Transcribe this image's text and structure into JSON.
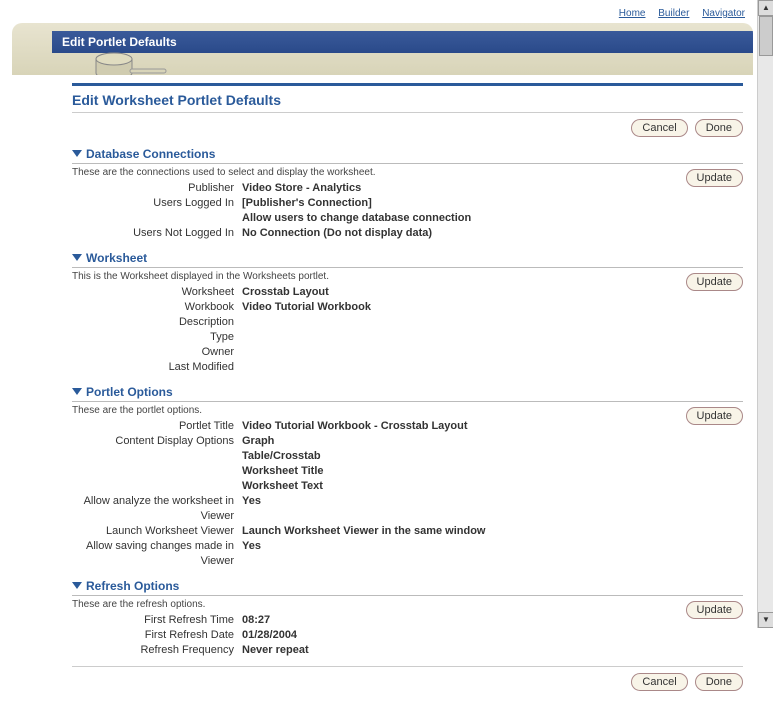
{
  "nav": {
    "home": "Home",
    "builder": "Builder",
    "navigator": "Navigator"
  },
  "banner": {
    "title": "Edit Portlet Defaults"
  },
  "page": {
    "title": "Edit Worksheet Portlet Defaults"
  },
  "buttons": {
    "cancel": "Cancel",
    "done": "Done",
    "update": "Update"
  },
  "sections": {
    "db": {
      "heading": "Database Connections",
      "desc": "These are the connections used to select and display the worksheet.",
      "rows": [
        {
          "label": "Publisher",
          "value": "Video Store - Analytics"
        },
        {
          "label": "Users Logged In",
          "value": "[Publisher's Connection]"
        },
        {
          "label": "",
          "value": "Allow users to change database connection"
        },
        {
          "label": "Users Not Logged In",
          "value": "No Connection (Do not display data)"
        }
      ]
    },
    "ws": {
      "heading": "Worksheet",
      "desc": "This is the Worksheet displayed in the Worksheets portlet.",
      "rows": [
        {
          "label": "Worksheet",
          "value": "Crosstab Layout"
        },
        {
          "label": "Workbook",
          "value": "Video Tutorial Workbook"
        },
        {
          "label": "Description",
          "value": ""
        },
        {
          "label": "Type",
          "value": ""
        },
        {
          "label": "Owner",
          "value": ""
        },
        {
          "label": "Last Modified",
          "value": ""
        }
      ]
    },
    "po": {
      "heading": "Portlet Options",
      "desc": "These are the portlet options.",
      "rows": [
        {
          "label": "Portlet Title",
          "value": "Video Tutorial Workbook - Crosstab Layout"
        },
        {
          "label": "Content Display Options",
          "value": "Graph"
        },
        {
          "label": "",
          "value": "Table/Crosstab"
        },
        {
          "label": "",
          "value": "Worksheet Title"
        },
        {
          "label": "",
          "value": "Worksheet Text"
        },
        {
          "label": "Allow analyze the worksheet in Viewer",
          "value": "Yes"
        },
        {
          "label": "Launch Worksheet Viewer",
          "value": "Launch Worksheet Viewer in the same window"
        },
        {
          "label": "Allow saving changes made in Viewer",
          "value": "Yes"
        }
      ]
    },
    "ro": {
      "heading": "Refresh Options",
      "desc": "These are the refresh options.",
      "rows": [
        {
          "label": "First Refresh Time",
          "value": "08:27"
        },
        {
          "label": "First Refresh Date",
          "value": "01/28/2004"
        },
        {
          "label": "Refresh Frequency",
          "value": "Never repeat"
        }
      ]
    }
  }
}
